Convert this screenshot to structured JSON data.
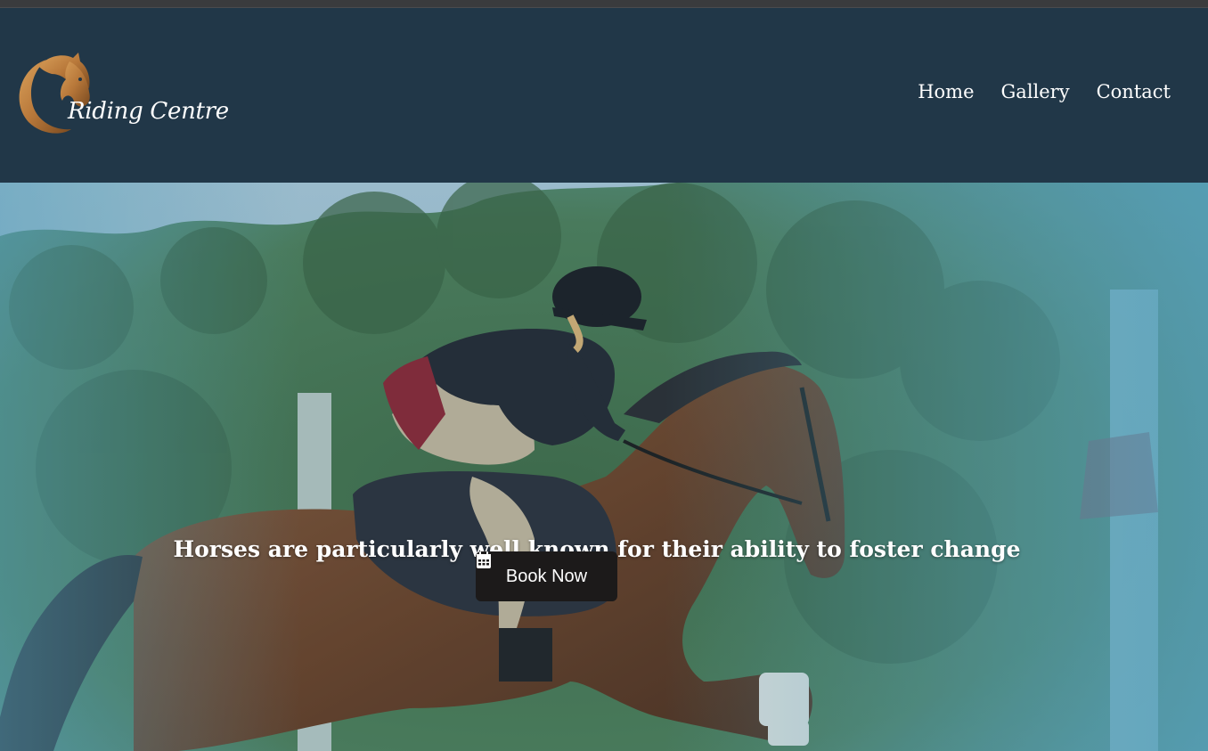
{
  "brand": {
    "name": "Riding Centre",
    "icon": "horse-head-icon"
  },
  "nav": {
    "items": [
      {
        "label": "Home"
      },
      {
        "label": "Gallery"
      },
      {
        "label": "Contact"
      }
    ]
  },
  "hero": {
    "tagline": "Horses are particularly well known for their ability to foster change",
    "cta_label": "Book Now",
    "cta_icon": "calendar-icon",
    "image": "rider-jumping-horse-photo"
  },
  "colors": {
    "header_bg": "#213748",
    "button_bg": "#1c1a1a",
    "logo_accent": "#b8783a",
    "hero_tint": "#5aa8c4"
  }
}
